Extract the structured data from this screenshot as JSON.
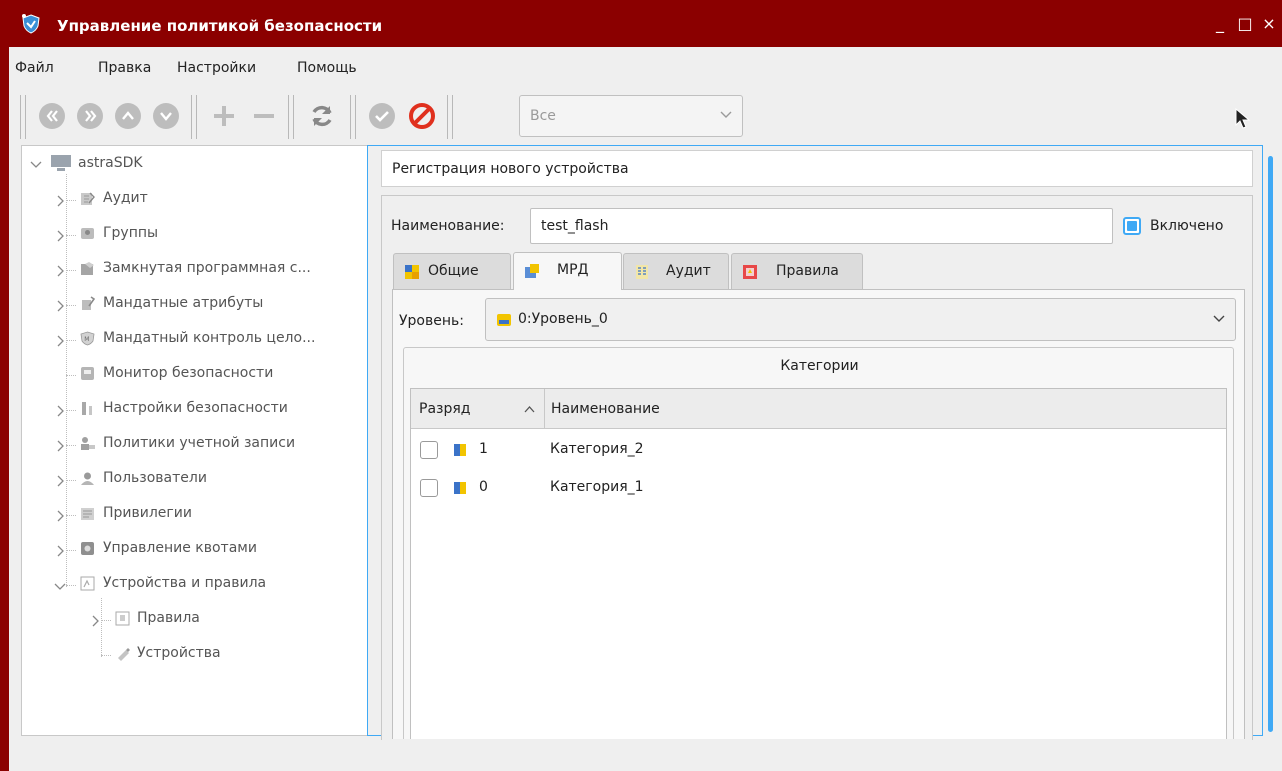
{
  "window": {
    "title": "Управление политикой безопасности",
    "minimize": "_",
    "maximize": "□",
    "close": "×"
  },
  "menu": {
    "file": "Файл",
    "edit": "Правка",
    "settings": "Настройки",
    "help": "Помощь"
  },
  "toolbar": {
    "filter_value": "Все"
  },
  "tree": {
    "root": "astraSDK",
    "items": [
      {
        "label": "Аудит"
      },
      {
        "label": "Группы"
      },
      {
        "label": "Замкнутая программная с..."
      },
      {
        "label": "Мандатные атрибуты"
      },
      {
        "label": "Мандатный контроль цело..."
      },
      {
        "label": "Монитор безопасности"
      },
      {
        "label": "Настройки безопасности"
      },
      {
        "label": "Политики учетной записи"
      },
      {
        "label": "Пользователи"
      },
      {
        "label": "Привилегии"
      },
      {
        "label": "Управление квотами"
      },
      {
        "label": "Устройства и правила"
      }
    ],
    "children": [
      {
        "label": "Правила"
      },
      {
        "label": "Устройства"
      }
    ]
  },
  "form": {
    "header": "Регистрация нового устройства",
    "name_label": "Наименование:",
    "name_value": "test_flash",
    "enabled_label": "Включено",
    "tabs": [
      {
        "label": "Общие"
      },
      {
        "label": "МРД"
      },
      {
        "label": "Аудит"
      },
      {
        "label": "Правила"
      }
    ],
    "level_label": "Уровень:",
    "level_value": "0:Уровень_0",
    "categories_title": "Категории",
    "columns": {
      "rank": "Разряд",
      "name": "Наименование"
    },
    "rows": [
      {
        "rank": "1",
        "name": "Категория_2"
      },
      {
        "rank": "0",
        "name": "Категория_1"
      }
    ]
  },
  "colors": {
    "titlebar": "#8b0000",
    "accent": "#3fa9f5"
  }
}
